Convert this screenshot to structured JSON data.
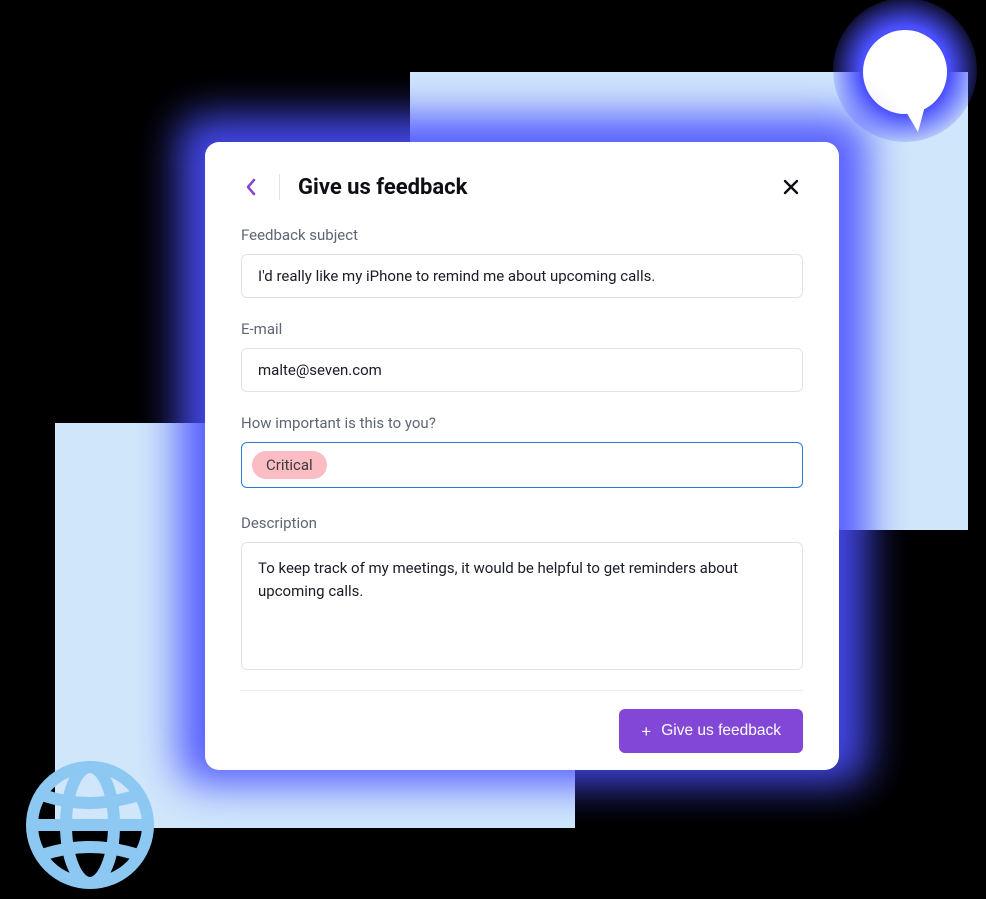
{
  "header": {
    "title": "Give us feedback"
  },
  "form": {
    "subject": {
      "label": "Feedback subject",
      "value": "I'd really like my iPhone to remind me about upcoming calls."
    },
    "email": {
      "label": "E-mail",
      "value": "malte@seven.com"
    },
    "importance": {
      "label": "How important is this to you?",
      "selected": "Critical"
    },
    "description": {
      "label": "Description",
      "value": "To keep track of my meetings, it would be helpful to get reminders about upcoming calls."
    }
  },
  "submit": {
    "label": "Give us feedback"
  },
  "colors": {
    "accent": "#8247d6",
    "focus": "#2a7ad6",
    "chip": "#f9bdc3"
  }
}
